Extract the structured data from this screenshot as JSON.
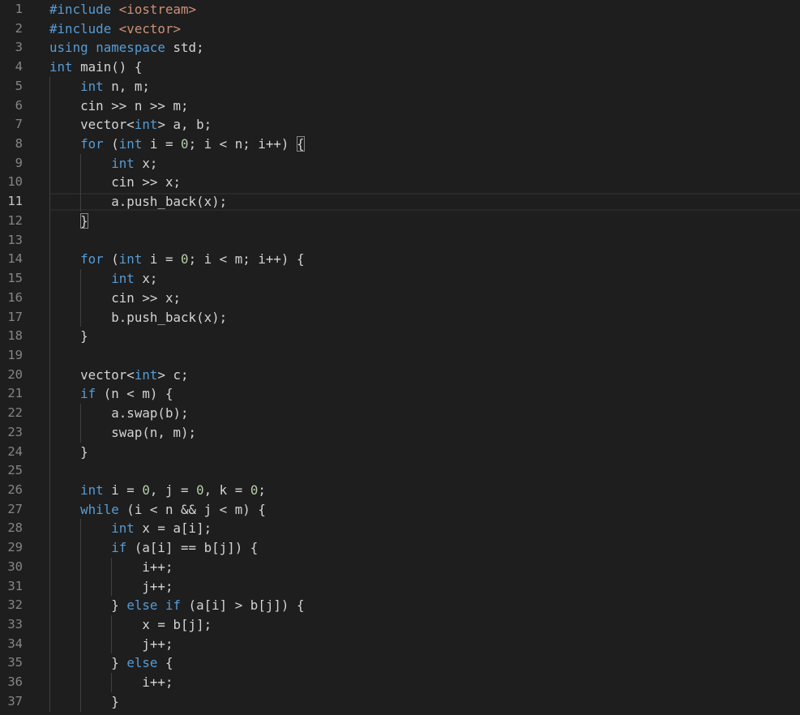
{
  "editor": {
    "language": "cpp",
    "current_line": 11,
    "colors": {
      "background": "#1e1e1e",
      "keyword": "#569cd6",
      "string": "#ce9178",
      "number": "#b5cea8",
      "text": "#d4d4d4",
      "line_number": "#858585",
      "line_number_active": "#c6c6c6"
    },
    "lines": [
      {
        "n": "1",
        "tokens": [
          [
            "kw",
            "#include"
          ],
          [
            "txt",
            " "
          ],
          [
            "str",
            "<iostream>"
          ]
        ]
      },
      {
        "n": "2",
        "tokens": [
          [
            "kw",
            "#include"
          ],
          [
            "txt",
            " "
          ],
          [
            "str",
            "<vector>"
          ]
        ]
      },
      {
        "n": "3",
        "tokens": [
          [
            "kw",
            "using"
          ],
          [
            "txt",
            " "
          ],
          [
            "kw",
            "namespace"
          ],
          [
            "txt",
            " std;"
          ]
        ]
      },
      {
        "n": "4",
        "tokens": [
          [
            "kw",
            "int"
          ],
          [
            "txt",
            " main() {"
          ]
        ]
      },
      {
        "n": "5",
        "tokens": [
          [
            "txt",
            "    "
          ],
          [
            "kw",
            "int"
          ],
          [
            "txt",
            " n, m;"
          ]
        ]
      },
      {
        "n": "6",
        "tokens": [
          [
            "txt",
            "    cin >> n >> m;"
          ]
        ]
      },
      {
        "n": "7",
        "tokens": [
          [
            "txt",
            "    vector<"
          ],
          [
            "kw",
            "int"
          ],
          [
            "txt",
            "> a, b;"
          ]
        ]
      },
      {
        "n": "8",
        "tokens": [
          [
            "txt",
            "    "
          ],
          [
            "kw",
            "for"
          ],
          [
            "txt",
            " ("
          ],
          [
            "kw",
            "int"
          ],
          [
            "txt",
            " i = "
          ],
          [
            "num",
            "0"
          ],
          [
            "txt",
            "; i < n; i++) "
          ],
          [
            "bracket",
            "{"
          ]
        ]
      },
      {
        "n": "9",
        "tokens": [
          [
            "txt",
            "        "
          ],
          [
            "kw",
            "int"
          ],
          [
            "txt",
            " x;"
          ]
        ]
      },
      {
        "n": "10",
        "tokens": [
          [
            "txt",
            "        cin >> x;"
          ]
        ]
      },
      {
        "n": "11",
        "tokens": [
          [
            "txt",
            "        a.push_back(x);"
          ]
        ]
      },
      {
        "n": "12",
        "tokens": [
          [
            "txt",
            "    "
          ],
          [
            "bracket",
            "}"
          ]
        ]
      },
      {
        "n": "13",
        "tokens": []
      },
      {
        "n": "14",
        "tokens": [
          [
            "txt",
            "    "
          ],
          [
            "kw",
            "for"
          ],
          [
            "txt",
            " ("
          ],
          [
            "kw",
            "int"
          ],
          [
            "txt",
            " i = "
          ],
          [
            "num",
            "0"
          ],
          [
            "txt",
            "; i < m; i++) {"
          ]
        ]
      },
      {
        "n": "15",
        "tokens": [
          [
            "txt",
            "        "
          ],
          [
            "kw",
            "int"
          ],
          [
            "txt",
            " x;"
          ]
        ]
      },
      {
        "n": "16",
        "tokens": [
          [
            "txt",
            "        cin >> x;"
          ]
        ]
      },
      {
        "n": "17",
        "tokens": [
          [
            "txt",
            "        b.push_back(x);"
          ]
        ]
      },
      {
        "n": "18",
        "tokens": [
          [
            "txt",
            "    }"
          ]
        ]
      },
      {
        "n": "19",
        "tokens": []
      },
      {
        "n": "20",
        "tokens": [
          [
            "txt",
            "    vector<"
          ],
          [
            "kw",
            "int"
          ],
          [
            "txt",
            "> c;"
          ]
        ]
      },
      {
        "n": "21",
        "tokens": [
          [
            "txt",
            "    "
          ],
          [
            "kw",
            "if"
          ],
          [
            "txt",
            " (n < m) {"
          ]
        ]
      },
      {
        "n": "22",
        "tokens": [
          [
            "txt",
            "        a.swap(b);"
          ]
        ]
      },
      {
        "n": "23",
        "tokens": [
          [
            "txt",
            "        swap(n, m);"
          ]
        ]
      },
      {
        "n": "24",
        "tokens": [
          [
            "txt",
            "    }"
          ]
        ]
      },
      {
        "n": "25",
        "tokens": []
      },
      {
        "n": "26",
        "tokens": [
          [
            "txt",
            "    "
          ],
          [
            "kw",
            "int"
          ],
          [
            "txt",
            " i = "
          ],
          [
            "num",
            "0"
          ],
          [
            "txt",
            ", j = "
          ],
          [
            "num",
            "0"
          ],
          [
            "txt",
            ", k = "
          ],
          [
            "num",
            "0"
          ],
          [
            "txt",
            ";"
          ]
        ]
      },
      {
        "n": "27",
        "tokens": [
          [
            "txt",
            "    "
          ],
          [
            "kw",
            "while"
          ],
          [
            "txt",
            " (i < n && j < m) {"
          ]
        ]
      },
      {
        "n": "28",
        "tokens": [
          [
            "txt",
            "        "
          ],
          [
            "kw",
            "int"
          ],
          [
            "txt",
            " x = a[i];"
          ]
        ]
      },
      {
        "n": "29",
        "tokens": [
          [
            "txt",
            "        "
          ],
          [
            "kw",
            "if"
          ],
          [
            "txt",
            " (a[i] == b[j]) {"
          ]
        ]
      },
      {
        "n": "30",
        "tokens": [
          [
            "txt",
            "            i++;"
          ]
        ]
      },
      {
        "n": "31",
        "tokens": [
          [
            "txt",
            "            j++;"
          ]
        ]
      },
      {
        "n": "32",
        "tokens": [
          [
            "txt",
            "        } "
          ],
          [
            "kw",
            "else"
          ],
          [
            "txt",
            " "
          ],
          [
            "kw",
            "if"
          ],
          [
            "txt",
            " (a[i] > b[j]) {"
          ]
        ]
      },
      {
        "n": "33",
        "tokens": [
          [
            "txt",
            "            x = b[j];"
          ]
        ]
      },
      {
        "n": "34",
        "tokens": [
          [
            "txt",
            "            j++;"
          ]
        ]
      },
      {
        "n": "35",
        "tokens": [
          [
            "txt",
            "        } "
          ],
          [
            "kw",
            "else"
          ],
          [
            "txt",
            " {"
          ]
        ]
      },
      {
        "n": "36",
        "tokens": [
          [
            "txt",
            "            i++;"
          ]
        ]
      },
      {
        "n": "37",
        "tokens": [
          [
            "txt",
            "        }"
          ]
        ]
      }
    ]
  }
}
